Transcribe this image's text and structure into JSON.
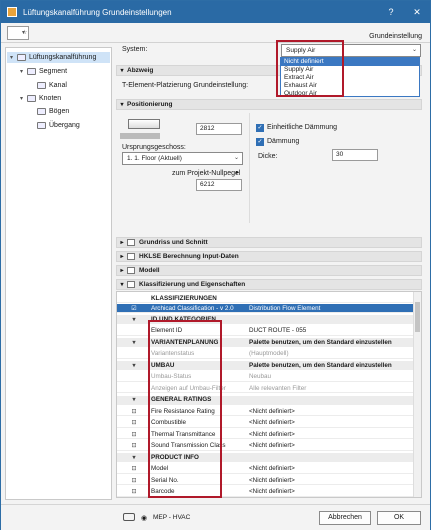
{
  "window": {
    "title": "Lüftungskanalführung Grundeinstellungen"
  },
  "toolbar": {
    "star": "☆",
    "caret": "▾",
    "settings_label": "Grundeinstellung"
  },
  "tree": [
    {
      "label": "Lüftungskanalführung",
      "indent": 0,
      "twisty": "▾",
      "selected": true
    },
    {
      "label": "Segment",
      "indent": 1,
      "twisty": "▾",
      "selected": false
    },
    {
      "label": "Kanal",
      "indent": 2,
      "twisty": "",
      "selected": false
    },
    {
      "label": "Knoten",
      "indent": 1,
      "twisty": "▾",
      "selected": false
    },
    {
      "label": "Bögen",
      "indent": 2,
      "twisty": "",
      "selected": false
    },
    {
      "label": "Übergang",
      "indent": 2,
      "twisty": "",
      "selected": false
    }
  ],
  "system": {
    "label": "System:",
    "value": "Supply Air",
    "options": [
      "Nicht definiert",
      "Supply Air",
      "Extract Air",
      "Exhaust Air",
      "Outdoor Air"
    ],
    "highlighted": "Nicht definiert"
  },
  "abzweig": {
    "title": "Abzweig",
    "t_element_label": "T-Element-Platzierung Grundeinstellung:"
  },
  "positionierung": {
    "title": "Positionierung",
    "value_top": "2812",
    "story_label": "Ursprungsgeschoss:",
    "story_value": "1. 1. Floor (Aktuell)",
    "proj_label": "zum Projekt-Nullpegel",
    "value_bottom": "6212",
    "uniform_insulation": "Einheitliche Dämmung",
    "insulation": "Dämmung",
    "thickness_label": "Dicke:",
    "thickness_value": "30"
  },
  "sections": [
    {
      "title": "Grundriss und Schnitt"
    },
    {
      "title": "HKLSE Berechnung Input-Daten"
    },
    {
      "title": "Modell"
    },
    {
      "title": "Klassifizierung und Eigenschaften"
    }
  ],
  "classification": {
    "header": "KLASSIFIZIERUNGEN",
    "system": "Archicad Classification - v 2.0",
    "value": "Distribution Flow Element"
  },
  "properties": [
    {
      "name": "ID UND KATEGORIEN",
      "value": "",
      "type": "hdr",
      "icon": "▾"
    },
    {
      "name": "Element ID",
      "value": "DUCT ROUTE - 055",
      "type": "row",
      "icon": ""
    },
    {
      "name": "VARIANTENPLANUNG",
      "value": "Palette benutzen, um den Standard einzustellen",
      "type": "hdr",
      "icon": "▾"
    },
    {
      "name": "Variantenstatus",
      "value": "(Hauptmodell)",
      "type": "dim",
      "icon": ""
    },
    {
      "name": "UMBAU",
      "value": "Palette benutzen, um den Standard einzustellen",
      "type": "hdr",
      "icon": "▾"
    },
    {
      "name": "Umbau-Status",
      "value": "Neubau",
      "type": "dim",
      "icon": ""
    },
    {
      "name": "Anzeigen auf Umbau-Filter",
      "value": "Alle relevanten Filter",
      "type": "dim",
      "icon": ""
    },
    {
      "name": "GENERAL RATINGS",
      "value": "",
      "type": "hdr",
      "icon": "▾"
    },
    {
      "name": "Fire Resistance Rating",
      "value": "<Nicht definiert>",
      "type": "row",
      "icon": "⊡"
    },
    {
      "name": "Combustible",
      "value": "<Nicht definiert>",
      "type": "row",
      "icon": "⊡"
    },
    {
      "name": "Thermal Transmittance",
      "value": "<Nicht definiert>",
      "type": "row",
      "icon": "⊡"
    },
    {
      "name": "Sound Transmission Class",
      "value": "<Nicht definiert>",
      "type": "row",
      "icon": "⊡"
    },
    {
      "name": "PRODUCT INFO",
      "value": "",
      "type": "hdr",
      "icon": "▾"
    },
    {
      "name": "Model",
      "value": "<Nicht definiert>",
      "type": "row",
      "icon": "⊡"
    },
    {
      "name": "Serial No.",
      "value": "<Nicht definiert>",
      "type": "row",
      "icon": "⊡"
    },
    {
      "name": "Barcode",
      "value": "<Nicht definiert>",
      "type": "row",
      "icon": "⊡"
    }
  ],
  "footer": {
    "mep": "MEP - HVAC",
    "cancel": "Abbrechen",
    "ok": "OK"
  }
}
